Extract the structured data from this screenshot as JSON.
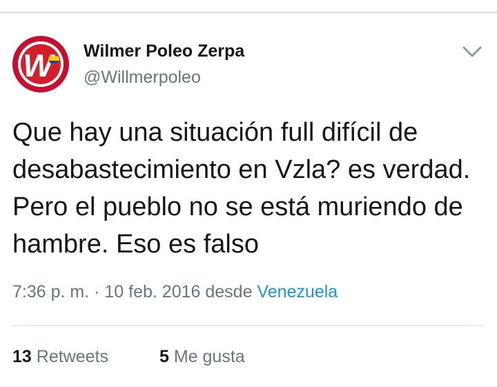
{
  "tweet": {
    "author_name": "Wilmer Poleo Zerpa",
    "handle": "@Willmerpoleo",
    "avatar": {
      "letter": "W",
      "icon": "avatar-logo-icon",
      "color_ring": "#c8102e",
      "color_inner": "#ffffff"
    },
    "text": "Que hay una situación full difícil de desabastecimiento en Vzla? es verdad. Pero el pueblo no se está muriendo de hambre. Eso es falso",
    "time": "7:36 p. m.",
    "separator": " · ",
    "date": "10 feb. 2016",
    "from_word": " desde ",
    "location": "Venezuela",
    "retweets": {
      "count": "13",
      "label": " Retweets"
    },
    "likes": {
      "count": "5",
      "label": " Me gusta"
    }
  },
  "colors": {
    "link": "#1b95e0",
    "secondary": "#657786",
    "primary": "#14171a"
  }
}
